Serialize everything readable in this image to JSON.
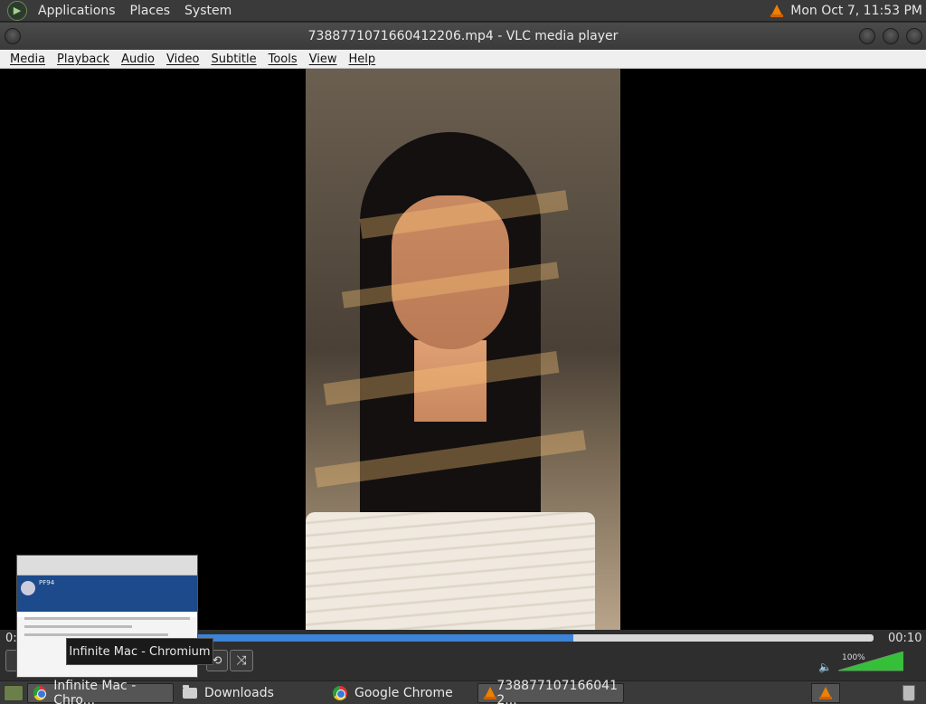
{
  "top_panel": {
    "menus": [
      "Applications",
      "Places",
      "System"
    ],
    "clock": "Mon Oct  7, 11:53 PM",
    "tray_icon": "vlc-cone-icon"
  },
  "window": {
    "title": "7388771071660412206.mp4 - VLC media player"
  },
  "menubar": [
    "Media",
    "Playback",
    "Audio",
    "Video",
    "Subtitle",
    "Tools",
    "View",
    "Help"
  ],
  "player": {
    "time_elapsed": "0:",
    "time_total": "00:10",
    "progress": 0.64,
    "volume_label": "100%",
    "volume_level": 1.0,
    "colors": {
      "seek_fill": "#3b84d8",
      "volume": "#36c03a"
    }
  },
  "tooltip": "Infinite Mac - Chromium",
  "preview": {
    "site_label": "PF94"
  },
  "taskbar": {
    "tasks": [
      {
        "label": "Infinite Mac - Chro...",
        "icon": "chromium-icon"
      },
      {
        "label": "Downloads",
        "icon": "folder-icon"
      },
      {
        "label": "Google Chrome",
        "icon": "chrome-icon"
      },
      {
        "label": "738877107166041 2...",
        "icon": "vlc-cone-icon"
      }
    ]
  }
}
